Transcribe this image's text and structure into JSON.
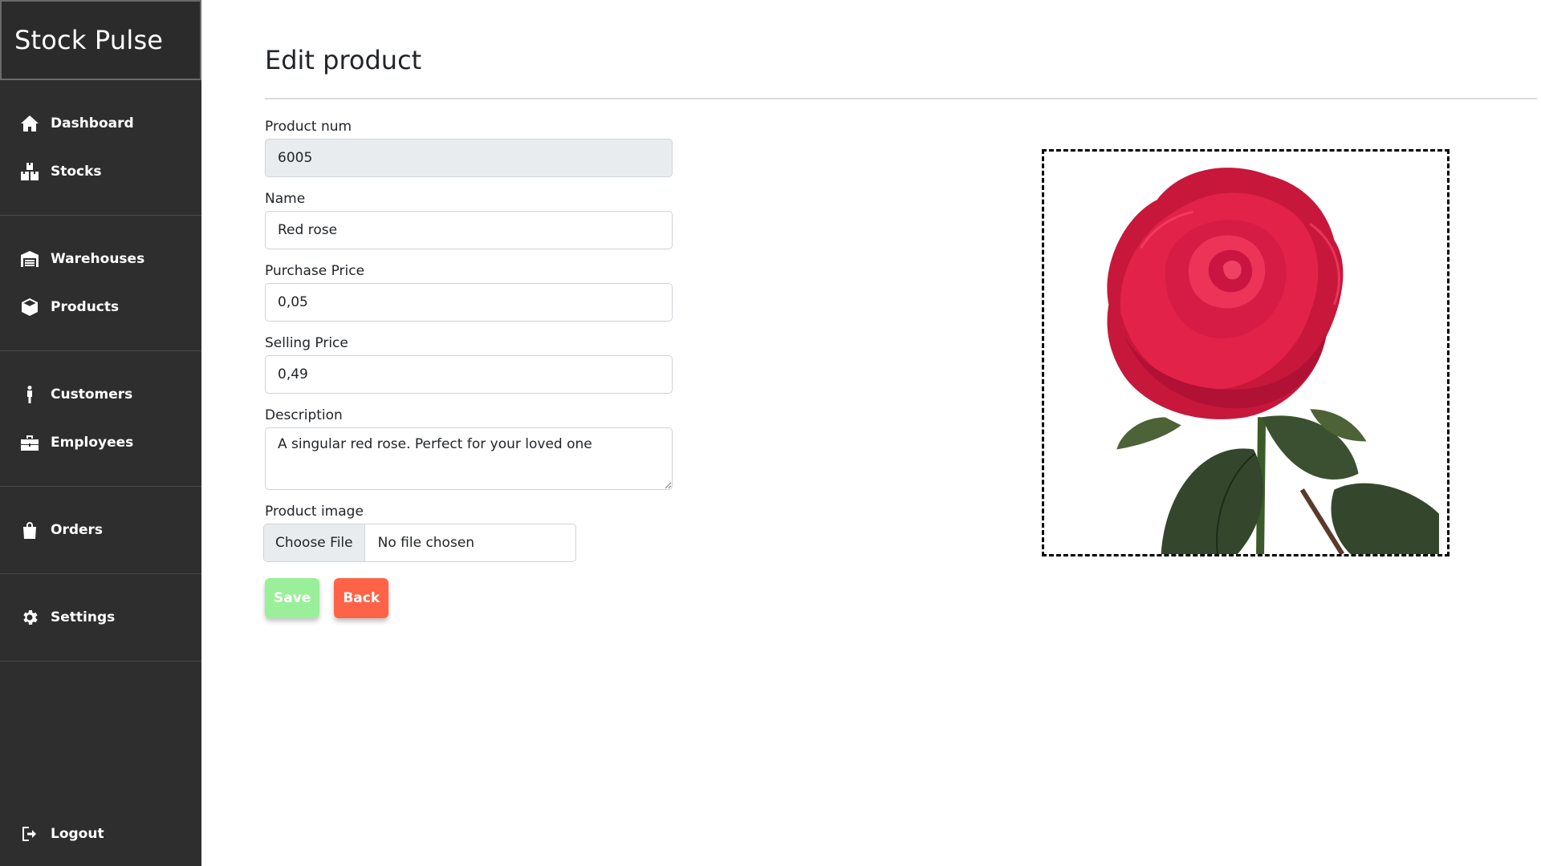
{
  "app": {
    "brand": "Stock Pulse"
  },
  "sidebar": {
    "groups": [
      {
        "items": [
          {
            "label": "Dashboard",
            "icon": "home-icon"
          },
          {
            "label": "Stocks",
            "icon": "boxes-icon"
          }
        ]
      },
      {
        "items": [
          {
            "label": "Warehouses",
            "icon": "warehouse-icon"
          },
          {
            "label": "Products",
            "icon": "box-icon"
          }
        ]
      },
      {
        "items": [
          {
            "label": "Customers",
            "icon": "person-icon"
          },
          {
            "label": "Employees",
            "icon": "briefcase-icon"
          }
        ]
      },
      {
        "items": [
          {
            "label": "Orders",
            "icon": "shopping-bag-icon"
          }
        ]
      },
      {
        "items": [
          {
            "label": "Settings",
            "icon": "gear-icon"
          }
        ]
      }
    ],
    "logout": {
      "label": "Logout",
      "icon": "logout-icon"
    }
  },
  "page": {
    "title": "Edit product"
  },
  "form": {
    "product_num": {
      "label": "Product num",
      "value": "6005"
    },
    "name": {
      "label": "Name",
      "value": "Red rose"
    },
    "purchase_price": {
      "label": "Purchase Price",
      "value": "0,05"
    },
    "selling_price": {
      "label": "Selling Price",
      "value": "0,49"
    },
    "description": {
      "label": "Description",
      "value": "A singular red rose. Perfect for your loved one"
    },
    "image": {
      "label": "Product image",
      "button": "Choose File",
      "status": "No file chosen"
    },
    "save_label": "Save",
    "back_label": "Back"
  },
  "colors": {
    "sidebar": "#2e2e2e",
    "save": "#90ee90",
    "back": "#ff6347",
    "rose": "#e8254a"
  }
}
